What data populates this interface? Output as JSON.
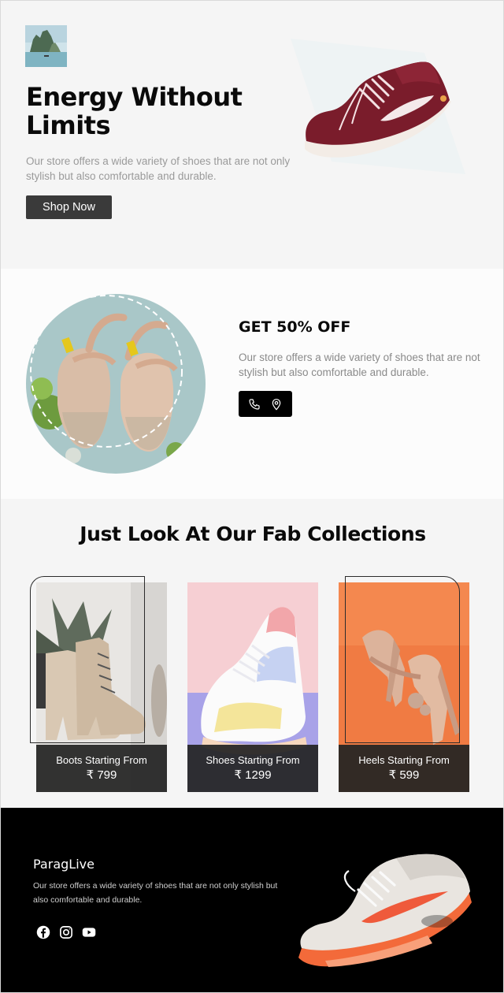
{
  "hero": {
    "title": "Energy Without Limits",
    "description": "Our store offers a wide variety of shoes that are not only stylish but also comfortable and durable.",
    "cta_label": "Shop Now"
  },
  "offer": {
    "title": "GET 50% OFF",
    "description": "Our store offers a wide variety of shoes that are not stylish but also comfortable and durable.",
    "actions": [
      {
        "icon": "phone-icon"
      },
      {
        "icon": "location-pin-icon"
      }
    ]
  },
  "collections": {
    "title": "Just Look At Our Fab Collections",
    "items": [
      {
        "label": "Boots Starting From",
        "price": "₹ 799"
      },
      {
        "label": "Shoes Starting From",
        "price": "₹ 1299"
      },
      {
        "label": "Heels Starting From",
        "price": "₹ 599"
      }
    ]
  },
  "footer": {
    "brand": "ParagLive",
    "description": "Our store offers a wide variety of shoes that are not only stylish but also comfortable and durable.",
    "socials": [
      {
        "icon": "facebook-icon"
      },
      {
        "icon": "instagram-icon"
      },
      {
        "icon": "youtube-icon"
      }
    ]
  },
  "colors": {
    "hero_bg": "#f5f5f5",
    "button_dark": "#3a3a3a",
    "footer_bg": "#000000",
    "caption_bg": "#232323"
  }
}
